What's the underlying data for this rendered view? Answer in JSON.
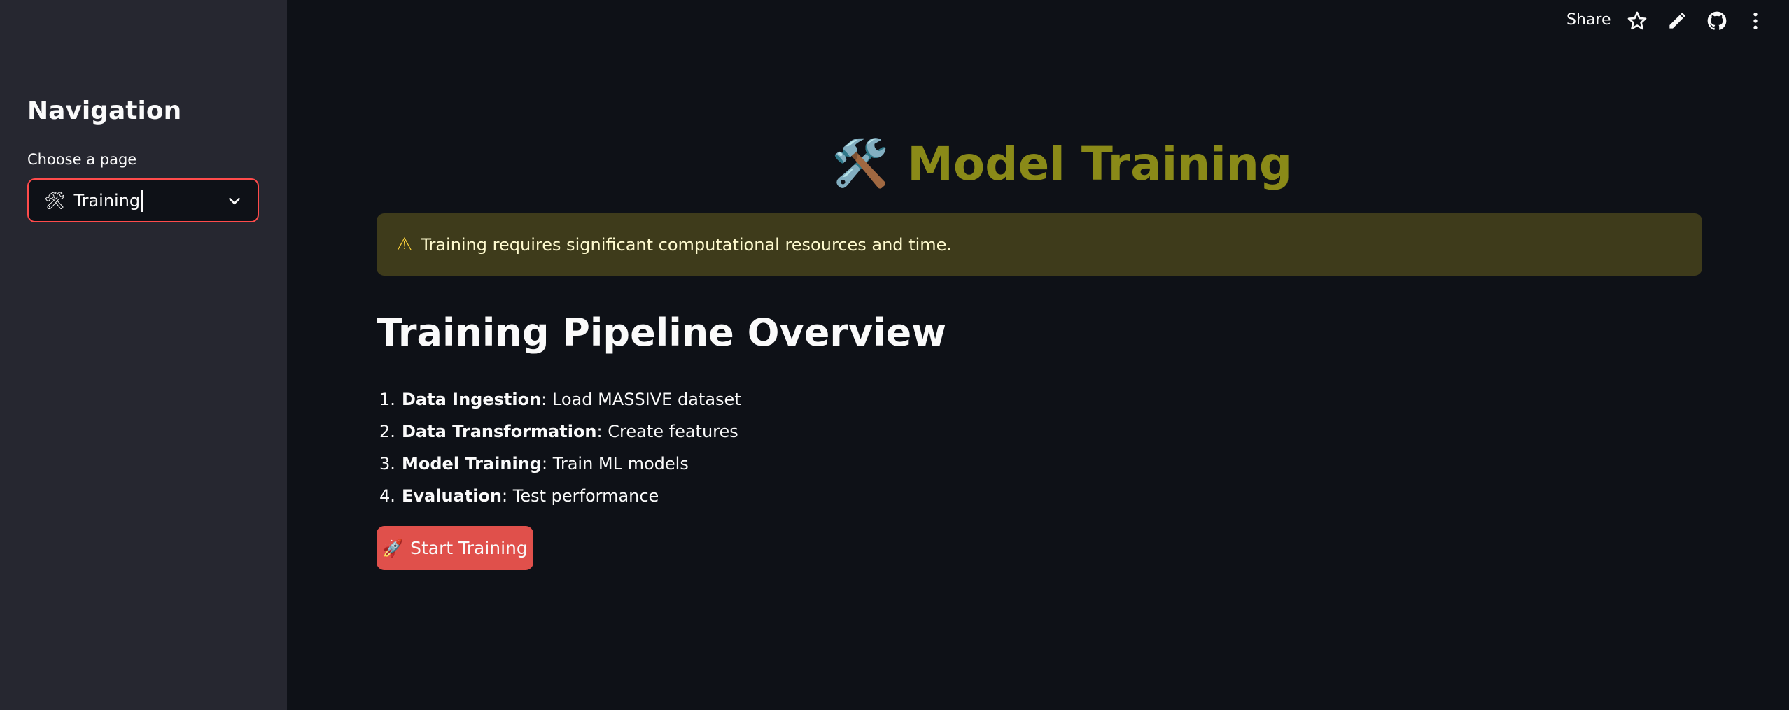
{
  "sidebar": {
    "title": "Navigation",
    "select_label": "Choose a page",
    "select_icon": "🛠",
    "select_value": "Training"
  },
  "toolbar": {
    "share_label": "Share"
  },
  "main": {
    "title_emoji": "🛠️",
    "title": "Model Training",
    "warning": {
      "icon": "⚠",
      "text": "Training requires significant computational resources and time."
    },
    "section_heading": "Training Pipeline Overview",
    "steps": [
      {
        "num": "1.",
        "name": "Data Ingestion",
        "desc": ": Load MASSIVE dataset"
      },
      {
        "num": "2.",
        "name": "Data Transformation",
        "desc": ": Create features"
      },
      {
        "num": "3.",
        "name": "Model Training",
        "desc": ": Train ML models"
      },
      {
        "num": "4.",
        "name": "Evaluation",
        "desc": ": Test performance"
      }
    ],
    "start_button": {
      "icon": "🚀",
      "label": "Start Training"
    }
  },
  "colors": {
    "sidebar_bg": "#262730",
    "main_bg": "#0e1117",
    "accent": "#ff4b4b",
    "title_color": "#8a8a18",
    "warning_bg": "#3e3b1b",
    "button_bg": "#e0504b"
  }
}
